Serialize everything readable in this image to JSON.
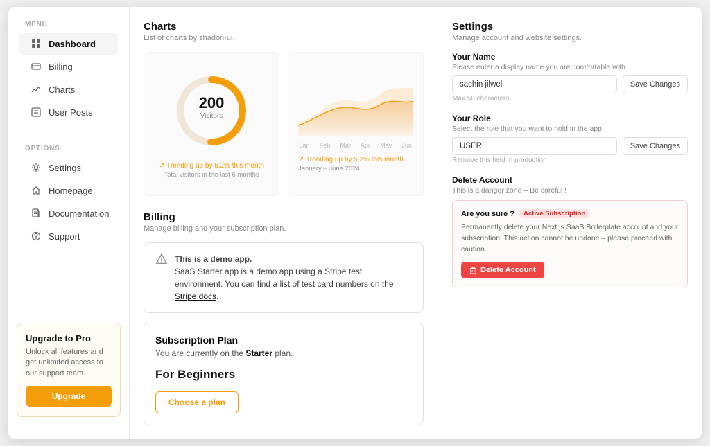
{
  "sidebar": {
    "menu_label": "MENU",
    "options_label": "OPTIONS",
    "items": [
      {
        "id": "dashboard",
        "label": "Dashboard",
        "icon": "dashboard",
        "active": true
      },
      {
        "id": "billing",
        "label": "Billing",
        "icon": "billing"
      },
      {
        "id": "charts",
        "label": "Charts",
        "icon": "charts"
      },
      {
        "id": "user-posts",
        "label": "User Posts",
        "icon": "posts"
      }
    ],
    "options": [
      {
        "id": "settings",
        "label": "Settings",
        "icon": "settings"
      },
      {
        "id": "homepage",
        "label": "Homepage",
        "icon": "home"
      },
      {
        "id": "documentation",
        "label": "Documentation",
        "icon": "docs"
      },
      {
        "id": "support",
        "label": "Support",
        "icon": "support"
      }
    ],
    "upgrade": {
      "title": "Upgrade to Pro",
      "description": "Unlock all features and get unlimited access to our support team.",
      "button_label": "Upgrade"
    }
  },
  "charts_section": {
    "title": "Charts",
    "subtitle": "List of charts by shadon-ui.",
    "donut": {
      "value": "200",
      "label": "Visitors",
      "trend": "Trending up by 5.2% this month",
      "sub": "Total visitors in the last 6 months"
    },
    "area": {
      "trend": "Trending up by 5.2% this month",
      "sub": "January – June 2024",
      "labels": [
        "Jan",
        "Feb",
        "Mar",
        "Apr",
        "May",
        "Jun"
      ]
    }
  },
  "billing_section": {
    "title": "Billing",
    "subtitle": "Manage billing and your subscription plan.",
    "demo_notice": {
      "line1": "This is a demo app.",
      "line2": "SaaS Starter app is a demo app using a Stripe test environment. You can find a list of test card numbers on the",
      "link_text": "Stripe docs",
      "line3": "."
    },
    "subscription": {
      "title": "Subscription Plan",
      "description_prefix": "You are currently on the ",
      "plan_bold": "Starter",
      "description_suffix": " plan.",
      "plan_name": "For Beginners",
      "button_label": "Choose a plan"
    }
  },
  "settings_section": {
    "title": "Settings",
    "subtitle": "Manage account and website settings.",
    "your_name": {
      "label": "Your Name",
      "description": "Please enter a display name you are comfortable with.",
      "value": "sachin jilwel",
      "char_hint": "Max 50 characters",
      "save_label": "Save Changes"
    },
    "your_role": {
      "label": "Your Role",
      "description": "Select the role that you want to hold in the app.",
      "value": "USER",
      "hint": "Remove this field in production",
      "save_label": "Save Changes"
    },
    "delete_account": {
      "label": "Delete Account",
      "description": "This is a danger zone – Be careful !",
      "confirm_title": "Are you sure ?",
      "active_badge": "Active Subscription",
      "confirm_text": "Permanently delete your Next.js SaaS Boilerplate account and your subscription. This action cannot be undone – please proceed with caution.",
      "delete_button": "Delete Account"
    }
  }
}
